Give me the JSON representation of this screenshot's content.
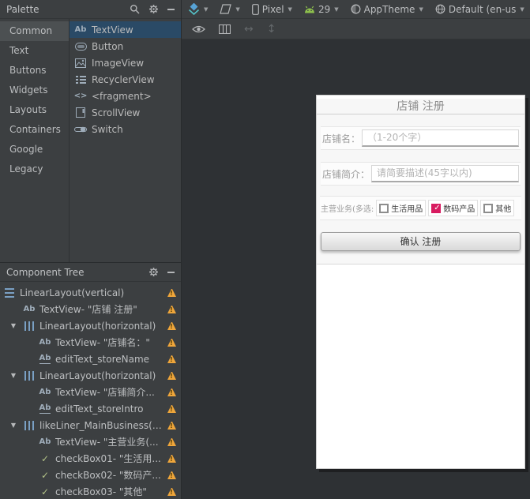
{
  "palette": {
    "title": "Palette",
    "categories": [
      {
        "label": "Common",
        "selected": true
      },
      {
        "label": "Text",
        "selected": false
      },
      {
        "label": "Buttons",
        "selected": false
      },
      {
        "label": "Widgets",
        "selected": false
      },
      {
        "label": "Layouts",
        "selected": false
      },
      {
        "label": "Containers",
        "selected": false
      },
      {
        "label": "Google",
        "selected": false
      },
      {
        "label": "Legacy",
        "selected": false
      }
    ],
    "components": [
      {
        "label": "TextView",
        "icon": "textview",
        "selected": true
      },
      {
        "label": "Button",
        "icon": "button",
        "selected": false
      },
      {
        "label": "ImageView",
        "icon": "imageview",
        "selected": false
      },
      {
        "label": "RecyclerView",
        "icon": "recyclerview",
        "selected": false
      },
      {
        "label": "<fragment>",
        "icon": "fragment",
        "selected": false
      },
      {
        "label": "ScrollView",
        "icon": "scrollview",
        "selected": false
      },
      {
        "label": "Switch",
        "icon": "switch",
        "selected": false
      }
    ]
  },
  "design_toolbar": {
    "device_label": "Pixel",
    "api_label": "29",
    "theme_label": "AppTheme",
    "locale_label": "Default (en-us"
  },
  "component_tree": {
    "title": "Component Tree",
    "items": [
      {
        "depth": 0,
        "arrow": false,
        "icon": "linear-v",
        "label": "LinearLayout(vertical)",
        "warning": true
      },
      {
        "depth": 1,
        "arrow": false,
        "icon": "textview",
        "label": "TextView- \"店铺 注册\"",
        "warning": true
      },
      {
        "depth": 1,
        "arrow": true,
        "icon": "linear-h",
        "label": "LinearLayout(horizontal)",
        "warning": true
      },
      {
        "depth": 2,
        "arrow": false,
        "icon": "textview",
        "label": "TextView- \"店铺名：\"",
        "warning": true
      },
      {
        "depth": 2,
        "arrow": false,
        "icon": "edittext",
        "label": "editText_storeName",
        "warning": true
      },
      {
        "depth": 1,
        "arrow": true,
        "icon": "linear-h",
        "label": "LinearLayout(horizontal)",
        "warning": true
      },
      {
        "depth": 2,
        "arrow": false,
        "icon": "textview",
        "label": "TextView- \"店铺简介...",
        "warning": true
      },
      {
        "depth": 2,
        "arrow": false,
        "icon": "edittext",
        "label": "editText_storeIntro",
        "warning": true
      },
      {
        "depth": 1,
        "arrow": true,
        "icon": "linear-h",
        "label": "likeLiner_MainBusiness(ho...",
        "warning": true
      },
      {
        "depth": 2,
        "arrow": false,
        "icon": "textview",
        "label": "TextView- \"主营业务(...",
        "warning": true
      },
      {
        "depth": 2,
        "arrow": false,
        "icon": "checkbox",
        "label": "checkBox01- \"生活用...",
        "warning": true
      },
      {
        "depth": 2,
        "arrow": false,
        "icon": "checkbox",
        "label": "checkBox02- \"数码产...",
        "warning": true
      },
      {
        "depth": 2,
        "arrow": false,
        "icon": "checkbox",
        "label": "checkBox03- \"其他\"",
        "warning": true
      }
    ]
  },
  "design_preview": {
    "title": "店铺 注册",
    "fields": [
      {
        "label": "店铺名：",
        "hint": "（1-20个字）"
      },
      {
        "label": "店铺简介：",
        "hint": "请简要描述(45字以内)"
      }
    ],
    "business_row": {
      "label": "主营业务(多选:",
      "options": [
        {
          "label": "生活用品",
          "checked": false
        },
        {
          "label": "数码产品",
          "checked": true
        },
        {
          "label": "其他",
          "checked": false
        }
      ]
    },
    "confirm_button": "确认 注册"
  },
  "colors": {
    "selection_blue": "#2a4a66",
    "category_selected": "#4c5052",
    "checkbox_accent": "#d81b60",
    "warning": "#efa63b"
  }
}
